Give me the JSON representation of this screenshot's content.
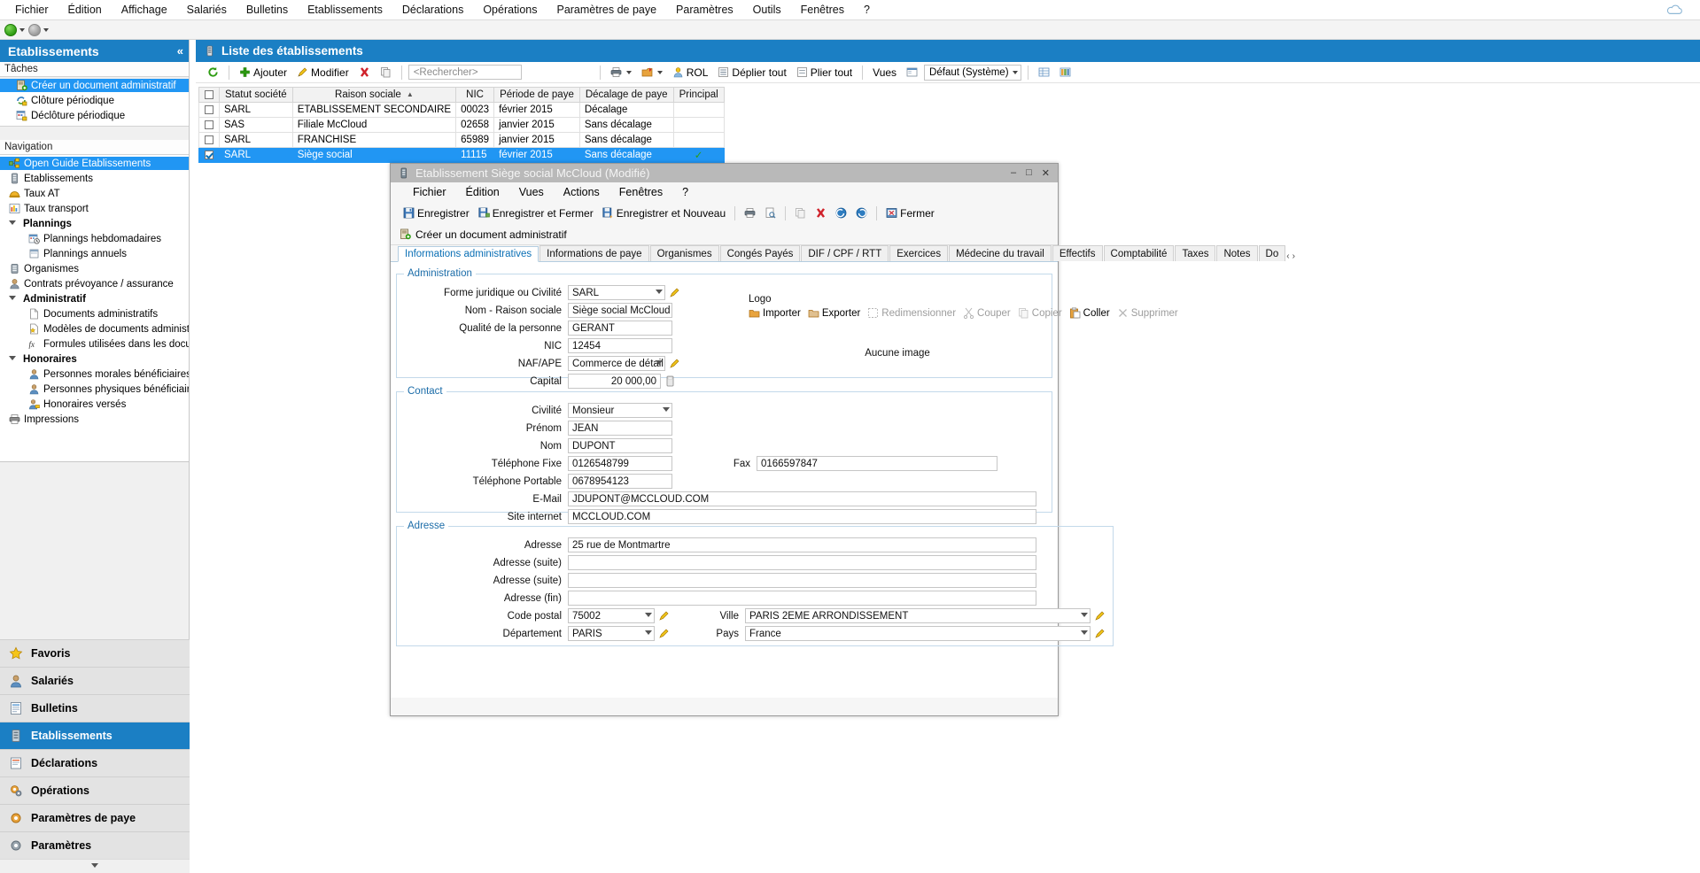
{
  "menubar": {
    "items": [
      "Fichier",
      "Édition",
      "Affichage",
      "Salariés",
      "Bulletins",
      "Etablissements",
      "Déclarations",
      "Opérations",
      "Paramètres de paye",
      "Paramètres",
      "Outils",
      "Fenêtres",
      "?"
    ]
  },
  "sidebar": {
    "title": "Etablissements",
    "collapse_glyph": "«",
    "tasks_header": "Tâches",
    "tasks": [
      {
        "label": "Créer un document administratif",
        "icon": "document-add-icon",
        "selected": true
      },
      {
        "label": "Clôture périodique",
        "icon": "lock-close-icon",
        "selected": false
      },
      {
        "label": "Déclôture périodique",
        "icon": "lock-open-icon",
        "selected": false
      }
    ],
    "nav_header": "Navigation",
    "nav": [
      {
        "label": "Open Guide Etablissements",
        "icon": "sitemap-icon",
        "level": 1,
        "selected": true
      },
      {
        "label": "Etablissements",
        "icon": "building-icon",
        "level": 1,
        "selected": false
      },
      {
        "label": "Taux AT",
        "icon": "helmet-icon",
        "level": 1,
        "selected": false
      },
      {
        "label": "Taux transport",
        "icon": "chart-icon",
        "level": 1,
        "selected": false
      },
      {
        "label": "Plannings",
        "icon": "triangle-icon",
        "level": 0,
        "group": true
      },
      {
        "label": "Plannings hebdomadaires",
        "icon": "calendar-clock-icon",
        "level": 2,
        "selected": false
      },
      {
        "label": "Plannings annuels",
        "icon": "calendar-icon",
        "level": 2,
        "selected": false
      },
      {
        "label": "Organismes",
        "icon": "server-icon",
        "level": 1,
        "selected": false
      },
      {
        "label": "Contrats prévoyance / assurance",
        "icon": "person-icon",
        "level": 1,
        "selected": false
      },
      {
        "label": "Administratif",
        "icon": "triangle-icon",
        "level": 0,
        "group": true
      },
      {
        "label": "Documents administratifs",
        "icon": "page-icon",
        "level": 2,
        "selected": false
      },
      {
        "label": "Modèles de documents administratifs",
        "icon": "page-star-icon",
        "level": 2,
        "selected": false
      },
      {
        "label": "Formules utilisées dans les documents ...",
        "icon": "fx-icon",
        "level": 2,
        "selected": false
      },
      {
        "label": "Honoraires",
        "icon": "triangle-icon",
        "level": 0,
        "group": true
      },
      {
        "label": "Personnes morales bénéficiaires",
        "icon": "person-icon",
        "level": 2,
        "selected": false
      },
      {
        "label": "Personnes physiques bénéficiaires",
        "icon": "person-icon",
        "level": 2,
        "selected": false
      },
      {
        "label": "Honoraires versés",
        "icon": "person-money-icon",
        "level": 2,
        "selected": false
      },
      {
        "label": "Impressions",
        "icon": "printer-icon",
        "level": 1,
        "selected": false
      }
    ],
    "buttons": [
      {
        "label": "Favoris",
        "icon": "star-icon",
        "active": false
      },
      {
        "label": "Salariés",
        "icon": "person-icon",
        "active": false
      },
      {
        "label": "Bulletins",
        "icon": "payslip-icon",
        "active": false
      },
      {
        "label": "Etablissements",
        "icon": "building-icon",
        "active": true
      },
      {
        "label": "Déclarations",
        "icon": "declaration-icon",
        "active": false
      },
      {
        "label": "Opérations",
        "icon": "gears-icon",
        "active": false
      },
      {
        "label": "Paramètres de paye",
        "icon": "settings-pay-icon",
        "active": false
      },
      {
        "label": "Paramètres",
        "icon": "settings-icon",
        "active": false
      }
    ]
  },
  "list_panel": {
    "title": "Liste des établissements",
    "toolbar": {
      "refresh": "refresh-icon",
      "add_label": "Ajouter",
      "modify_label": "Modifier",
      "delete_icon": "delete-icon",
      "copy_icon": "copy-icon",
      "search_placeholder": "<Rechercher>",
      "print_icon": "print-icon",
      "export_icon": "export-icon",
      "rol_label": "ROL",
      "expand_all_label": "Déplier tout",
      "collapse_all_label": "Plier tout",
      "views_label": "Vues",
      "view_selected": "Défaut (Système)",
      "grid_icon": "grid-icon",
      "columns_icon": "columns-icon"
    },
    "columns": [
      "",
      "Statut société",
      "Raison sociale",
      "NIC",
      "Période de paye",
      "Décalage de paye",
      "Principal"
    ],
    "sort_column": "Raison sociale",
    "rows": [
      {
        "checked": false,
        "statut": "SARL",
        "raison": "ETABLISSEMENT SECONDAIRE",
        "nic": "00023",
        "periode": "février 2015",
        "decalage": "Décalage",
        "principal": "",
        "selected": false
      },
      {
        "checked": false,
        "statut": "SAS",
        "raison": "Filiale McCloud",
        "nic": "02658",
        "periode": "janvier 2015",
        "decalage": "Sans décalage",
        "principal": "",
        "selected": false
      },
      {
        "checked": false,
        "statut": "SARL",
        "raison": "FRANCHISE",
        "nic": "65989",
        "periode": "janvier 2015",
        "decalage": "Sans décalage",
        "principal": "",
        "selected": false
      },
      {
        "checked": true,
        "statut": "SARL",
        "raison": "Siège social",
        "nic": "11115",
        "periode": "février 2015",
        "decalage": "Sans décalage",
        "principal": "✓",
        "selected": true
      }
    ]
  },
  "dialog": {
    "title": "Etablissement Siège social McCloud (Modifié)",
    "window_controls": [
      "–",
      "□",
      "✕"
    ],
    "menubar": [
      "Fichier",
      "Édition",
      "Vues",
      "Actions",
      "Fenêtres",
      "?"
    ],
    "toolbar": [
      {
        "label": "Enregistrer",
        "icon": "save-icon"
      },
      {
        "label": "Enregistrer et Fermer",
        "icon": "save-close-icon"
      },
      {
        "label": "Enregistrer et Nouveau",
        "icon": "save-new-icon"
      },
      {
        "label": "",
        "icon": "print-icon"
      },
      {
        "label": "",
        "icon": "preview-icon"
      },
      {
        "label": "",
        "icon": "copy-icon"
      },
      {
        "label": "",
        "icon": "delete-icon"
      },
      {
        "label": "",
        "icon": "back-icon"
      },
      {
        "label": "",
        "icon": "forward-icon"
      },
      {
        "label": "Fermer",
        "icon": "close-window-icon"
      }
    ],
    "action_label": "Créer un document administratif",
    "tabs": [
      {
        "label": "Informations administratives",
        "active": true
      },
      {
        "label": "Informations de paye",
        "active": false
      },
      {
        "label": "Organismes",
        "active": false
      },
      {
        "label": "Congés Payés",
        "active": false
      },
      {
        "label": "DIF / CPF / RTT",
        "active": false
      },
      {
        "label": "Exercices",
        "active": false
      },
      {
        "label": "Médecine du travail",
        "active": false
      },
      {
        "label": "Effectifs",
        "active": false
      },
      {
        "label": "Comptabilité",
        "active": false
      },
      {
        "label": "Taxes",
        "active": false
      },
      {
        "label": "Notes",
        "active": false
      },
      {
        "label": "Do",
        "active": false
      }
    ],
    "administration": {
      "legend": "Administration",
      "fields": [
        {
          "label": "Forme juridique ou Civilité",
          "value": "SARL",
          "type": "combo",
          "edit": true
        },
        {
          "label": "Nom - Raison sociale",
          "value": "Siège social McCloud",
          "type": "text",
          "edit": true
        },
        {
          "label": "Qualité de la personne",
          "value": "GERANT",
          "type": "text",
          "edit": false
        },
        {
          "label": "NIC",
          "value": "12454",
          "type": "text",
          "edit": false
        },
        {
          "label": "NAF/APE",
          "value": "Commerce de détail ...",
          "type": "combo",
          "edit": true
        },
        {
          "label": "Capital",
          "value": "20 000,00",
          "type": "amount",
          "edit": false
        }
      ],
      "logo": {
        "legend": "Logo",
        "ops": [
          {
            "label": "Importer",
            "icon": "folder-import-icon",
            "enabled": true
          },
          {
            "label": "Exporter",
            "icon": "folder-export-icon",
            "enabled": true
          },
          {
            "label": "Redimensionner",
            "icon": "resize-icon",
            "enabled": false
          },
          {
            "label": "Couper",
            "icon": "cut-icon",
            "enabled": false
          },
          {
            "label": "Copier",
            "icon": "copy-icon",
            "enabled": false
          },
          {
            "label": "Coller",
            "icon": "paste-icon",
            "enabled": true
          },
          {
            "label": "Supprimer",
            "icon": "delete-x-icon",
            "enabled": false
          }
        ],
        "empty_text": "Aucune image"
      }
    },
    "contact": {
      "legend": "Contact",
      "fields": [
        {
          "label": "Civilité",
          "value": "Monsieur",
          "type": "combo"
        },
        {
          "label": "Prénom",
          "value": "JEAN",
          "type": "text"
        },
        {
          "label": "Nom",
          "value": "DUPONT",
          "type": "text"
        },
        {
          "label": "Téléphone Fixe",
          "value": "0126548799",
          "type": "text"
        },
        {
          "label": "Téléphone Portable",
          "value": "0678954123",
          "type": "text"
        },
        {
          "label": "E-Mail",
          "value": "JDUPONT@MCCLOUD.COM",
          "type": "wide"
        },
        {
          "label": "Site internet",
          "value": "MCCLOUD.COM",
          "type": "wide"
        }
      ],
      "fax_label": "Fax",
      "fax_value": "0166597847"
    },
    "adresse": {
      "legend": "Adresse",
      "fields": [
        {
          "label": "Adresse",
          "value": "25 rue de Montmartre"
        },
        {
          "label": "Adresse (suite)",
          "value": ""
        },
        {
          "label": "Adresse (suite)",
          "value": ""
        },
        {
          "label": "Adresse (fin)",
          "value": ""
        }
      ],
      "code_postal_label": "Code postal",
      "code_postal_value": "75002",
      "ville_label": "Ville",
      "ville_value": "PARIS 2EME ARRONDISSEMENT",
      "departement_label": "Département",
      "departement_value": "PARIS",
      "pays_label": "Pays",
      "pays_value": "France"
    }
  },
  "colors": {
    "accent": "#1b7fc4",
    "selection": "#2196f3",
    "titlebar": "#b9b9b9",
    "group_border": "#c3d9ea",
    "link": "#0a6fb5"
  }
}
